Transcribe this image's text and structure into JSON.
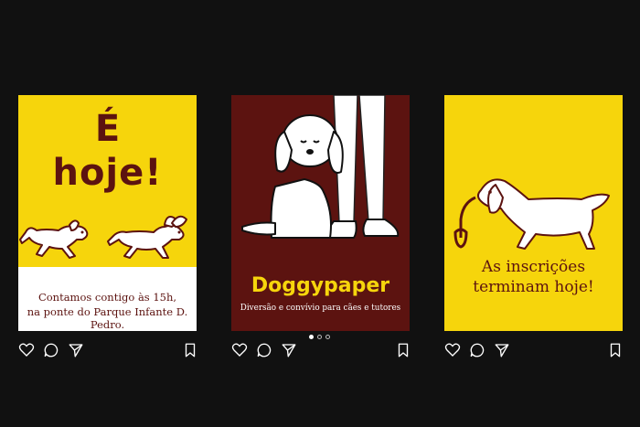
{
  "posts": [
    {
      "title_line1": "É",
      "title_line2": "hoje!",
      "text_line1": "Contamos contigo às 15h,",
      "text_line2": "na ponte do Parque Infante D. Pedro."
    },
    {
      "title": "Doggypaper",
      "subtitle": "Diversão e convívio para cães e tutores"
    },
    {
      "text_line1": "As inscrições",
      "text_line2": "terminam hoje!"
    }
  ],
  "carousel": {
    "active_index": 1,
    "count": 3
  },
  "actions": [
    "heart-icon",
    "comment-icon",
    "share-icon",
    "bookmark-icon"
  ],
  "colors": {
    "background": "#111111",
    "yellow": "#f6d50c",
    "maroon": "#5c1310",
    "white": "#ffffff"
  }
}
